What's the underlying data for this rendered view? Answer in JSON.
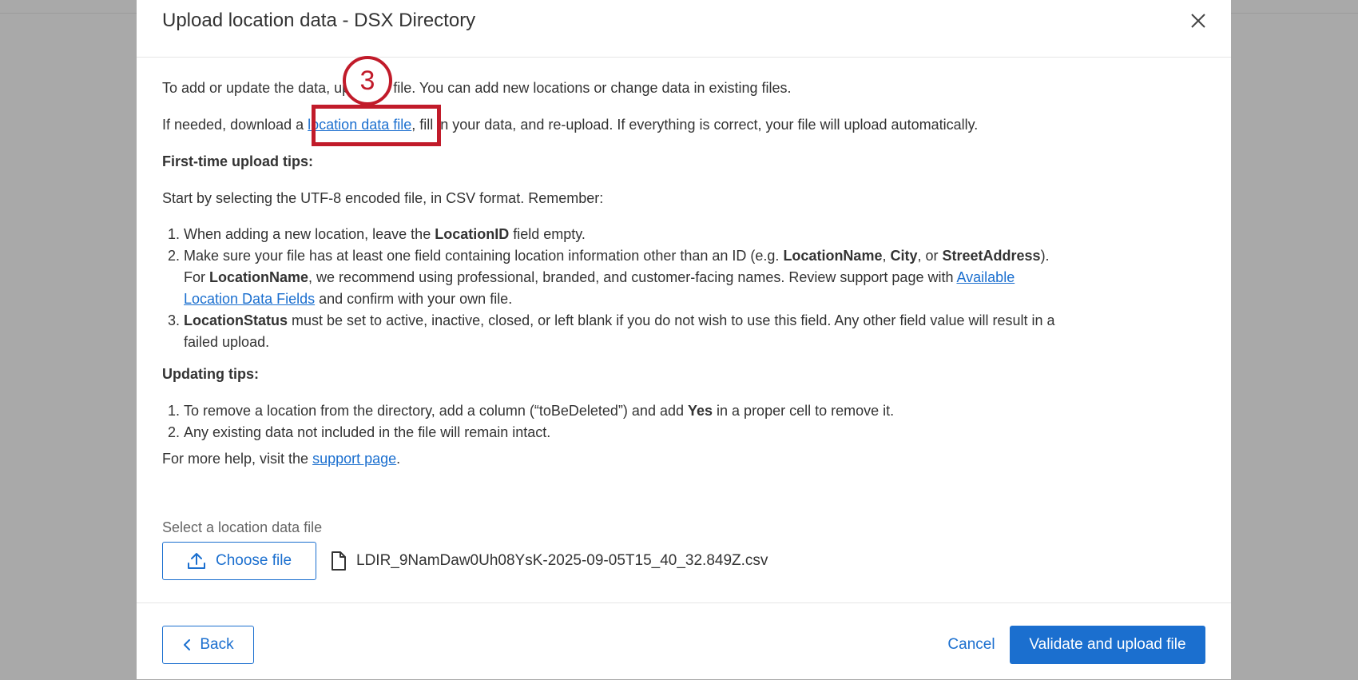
{
  "modal": {
    "title": "Upload location data - DSX Directory"
  },
  "intro": {
    "text": "To add or update the data, upload a file. You can add new locations or change data in existing files."
  },
  "download": {
    "before": "If needed, download a ",
    "link": "location data file",
    "after": ", fill in your data, and re-upload. If everything is correct, your file will upload automatically."
  },
  "first_time": {
    "heading": "First-time upload tips:",
    "start_text": "Start by selecting the UTF-8 encoded file, in CSV format. Remember:",
    "item1": {
      "pre": "When adding a new location, leave the ",
      "bold": "LocationID",
      "post": " field empty."
    },
    "item2": {
      "pre": "Make sure your file has at least one field containing location information other than an ID (e.g. ",
      "b1": "LocationName",
      "sep1": ", ",
      "b2": "City",
      "sep2": ", or ",
      "b3": "StreetAddress",
      "mid": "). For ",
      "b4": "LocationName",
      "post": ", we recommend using professional, branded, and customer-facing names. Review support page with ",
      "link": "Available Location Data Fields",
      "end": " and confirm with your own file."
    },
    "item3": {
      "bold": "LocationStatus",
      "post": " must be set to active, inactive, closed, or left blank if you do not wish to use this field. Any other field value will result in a failed upload."
    }
  },
  "updating": {
    "heading": "Updating tips:",
    "item1": {
      "pre": "To remove a location from the directory, add a column (“toBeDeleted”) and add ",
      "bold": "Yes",
      "post": " in a proper cell to remove it."
    },
    "item2": {
      "text": "Any existing data not included in the file will remain intact."
    }
  },
  "help": {
    "pre": "For more help, visit the ",
    "link": "support page",
    "post": "."
  },
  "file_select": {
    "label": "Select a location data file",
    "choose_label": "Choose file",
    "filename": "LDIR_9NamDaw0Uh08YsK-2025-09-05T15_40_32.849Z.csv"
  },
  "footer": {
    "back_label": "Back",
    "cancel_label": "Cancel",
    "validate_label": "Validate and upload file"
  },
  "annotation": {
    "step": "3"
  },
  "colors": {
    "accent": "#1b6fcf",
    "annotation": "#c11b2a"
  }
}
